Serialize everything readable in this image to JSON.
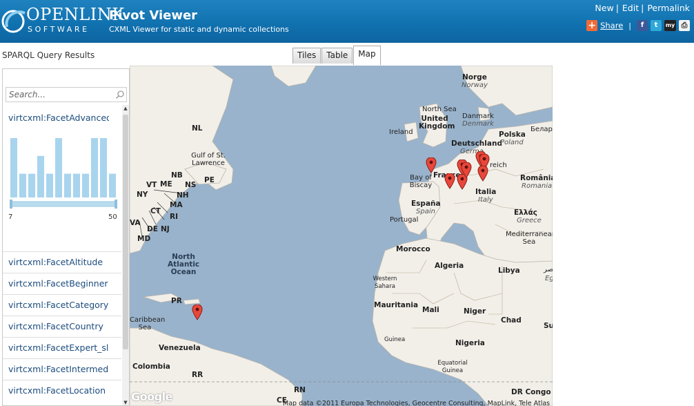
{
  "header": {
    "logo_word": "OPENLINK",
    "logo_sub": "SOFTWARE",
    "title": "Pivot Viewer",
    "subtitle": "CXML Viewer for static and dynamic collections",
    "links": [
      "New",
      "Edit",
      "Permalink"
    ],
    "share_label": "Share",
    "share_icons": [
      "plus-icon",
      "facebook-icon",
      "twitter-icon",
      "myspace-icon",
      "print-icon"
    ],
    "brand_color": "#1172b0"
  },
  "results_label": "SPARQL Query Results",
  "tabs": [
    {
      "label": "Tiles",
      "active": false
    },
    {
      "label": "Table",
      "active": false
    },
    {
      "label": "Map",
      "active": true
    }
  ],
  "facets": {
    "search_placeholder": "Search...",
    "first_facet": "virtcxml:FacetAdvanced",
    "histogram": [
      10,
      4,
      4,
      7,
      4,
      10,
      4,
      4,
      4,
      10,
      10,
      4
    ],
    "histogram_max": 10,
    "range_min": "7",
    "range_max": "50",
    "items": [
      "virtcxml:FacetAltitude",
      "virtcxml:FacetBeginner",
      "virtcxml:FacetCategory",
      "virtcxml:FacetCountry",
      "virtcxml:FacetExpert_sl",
      "virtcxml:FacetIntermed",
      "virtcxml:FacetLocation"
    ]
  },
  "map": {
    "ocean_color": "#99b3cc",
    "land_color": "#f2efe9",
    "labels": {
      "nl": "NL",
      "gulf": "Gulf of St. Lawrence",
      "nb": "NB",
      "pe": "PE",
      "ns": "NS",
      "vt": "VT",
      "me": "ME",
      "nh": "NH",
      "ny": "NY",
      "ma": "MA",
      "ct": "CT",
      "ri": "RI",
      "va": "VA",
      "de": "DE",
      "nj": "NJ",
      "md": "MD",
      "atlantic": "North Atlantic Ocean",
      "pr": "PR",
      "caribbean": "Caribbean Sea",
      "venezuela": "Venezuela",
      "colombia": "Colombia",
      "rr": "RR",
      "rn": "RN",
      "ce": "CE",
      "norge": "Norge",
      "norway": "Norway",
      "north_sea": "North Sea",
      "danmark": "Danmark",
      "denmark": "Denmark",
      "uk": "United Kingdom",
      "ireland": "Ireland",
      "deutschland": "Deutschland",
      "germany": "Germa",
      "polska": "Polska",
      "poland": "Poland",
      "belarus": "Беларуі",
      "reich": "reich",
      "bay": "Bay of Biscay",
      "france": "France",
      "romania": "România",
      "romania_en": "Romania",
      "italia": "Italia",
      "italy": "Italy",
      "espana": "España",
      "spain": "Spain",
      "portugal": "Portugal",
      "ellas": "Ελλάς",
      "greece": "Greece",
      "mediterranean": "Mediterranean Sea",
      "morocco": "Morocco",
      "algeria": "Algeria",
      "libya": "Libya",
      "arabic": "مصر",
      "eg": "Eg",
      "western_sahara": "Western Sahara",
      "mauritania": "Mauritania",
      "mali": "Mali",
      "niger": "Niger",
      "chad": "Chad",
      "su": "Su",
      "guinea": "Guinea",
      "nigeria": "Nigeria",
      "equatorial_guinea": "Equatorial Guinea",
      "drcongo": "DR Congo"
    },
    "google_label": "Google",
    "attribution": "Map data ©2011 Europa Technologies, Geocentre Consulting, MapLink, Tele Atlas"
  }
}
